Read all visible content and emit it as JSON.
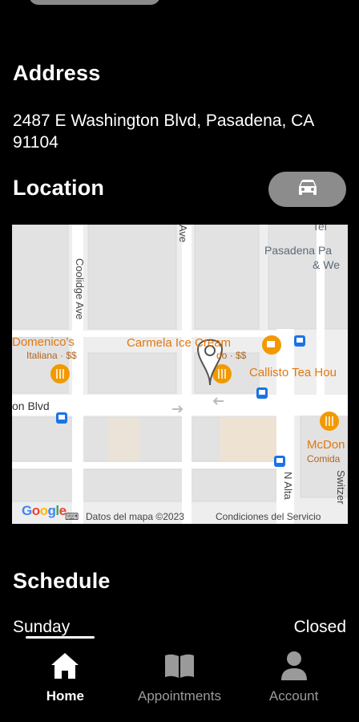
{
  "address": {
    "title": "Address",
    "line": "2487 E Washington Blvd, Pasadena, CA 91104"
  },
  "location": {
    "title": "Location",
    "directions_icon": "car-icon"
  },
  "map": {
    "labels": {
      "tel": "Tel",
      "pasadena_line1": "Pasadena Pa",
      "pasadena_line2": "& We",
      "coolidge": "Coolidge Ave",
      "ave": "Ave",
      "domenicos": "Domenico's",
      "domenicos_sub": "Italiana · $$",
      "carmela": "Carmela Ice Cream",
      "carmela_sub": "do · $$",
      "callisto": "Callisto Tea Hou",
      "blvd": "on Blvd",
      "mcdon": "McDon",
      "comida": "Comida",
      "n_alta": "N Alta",
      "switzer": "Switzer"
    },
    "footer": {
      "google": "Google",
      "map_data": "Datos del mapa ©2023",
      "terms": "Condiciones del Servicio"
    }
  },
  "schedule": {
    "title": "Schedule",
    "rows": [
      {
        "day": "Sunday",
        "hours": "Closed"
      }
    ]
  },
  "nav": {
    "items": [
      {
        "label": "Home",
        "icon": "home-icon",
        "active": true
      },
      {
        "label": "Appointments",
        "icon": "book-icon",
        "active": false
      },
      {
        "label": "Account",
        "icon": "person-icon",
        "active": false
      }
    ]
  },
  "colors": {
    "background": "#000000",
    "pill": "#8c8c8c",
    "nav_inactive": "#9a9a9a",
    "poi_orange": "#e07810",
    "transit_blue": "#1a73e8"
  }
}
